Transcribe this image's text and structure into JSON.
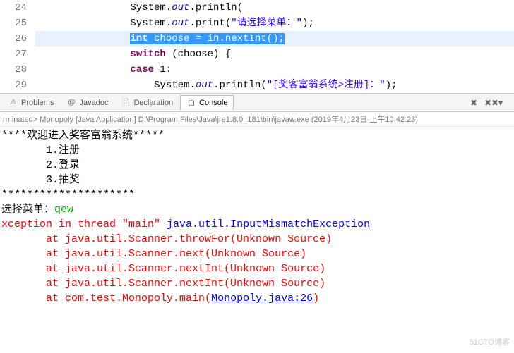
{
  "editor": {
    "lines": [
      {
        "num": "24",
        "indent": "                ",
        "tokens": [
          {
            "t": "System.",
            "c": ""
          },
          {
            "t": "out",
            "c": "field"
          },
          {
            "t": ".println(",
            "c": ""
          }
        ]
      },
      {
        "num": "25",
        "indent": "                ",
        "tokens": [
          {
            "t": "System.",
            "c": ""
          },
          {
            "t": "out",
            "c": "field"
          },
          {
            "t": ".print(",
            "c": ""
          },
          {
            "t": "\"请选择菜单：\"",
            "c": "str"
          },
          {
            "t": ");",
            "c": ""
          }
        ]
      },
      {
        "num": "26",
        "indent": "                ",
        "highlight": true,
        "selected": true,
        "tokens": [
          {
            "t": "int",
            "c": "kw"
          },
          {
            "t": " choose = in.nextInt();",
            "c": ""
          }
        ]
      },
      {
        "num": "27",
        "indent": "                ",
        "tokens": [
          {
            "t": "switch",
            "c": "kw"
          },
          {
            "t": " (choose) {",
            "c": ""
          }
        ]
      },
      {
        "num": "28",
        "indent": "                ",
        "tokens": [
          {
            "t": "case",
            "c": "kw"
          },
          {
            "t": " 1:",
            "c": ""
          }
        ]
      },
      {
        "num": "29",
        "indent": "                    ",
        "tokens": [
          {
            "t": "System.",
            "c": ""
          },
          {
            "t": "out",
            "c": "field"
          },
          {
            "t": ".println(",
            "c": ""
          },
          {
            "t": "\"[奖客富翁系统>注册]：\"",
            "c": "str"
          },
          {
            "t": ");",
            "c": ""
          }
        ]
      }
    ]
  },
  "views": {
    "tabs": [
      {
        "label": "Problems",
        "icon": "⚠",
        "active": false
      },
      {
        "label": "Javadoc",
        "icon": "@",
        "active": false
      },
      {
        "label": "Declaration",
        "icon": "📄",
        "active": false
      },
      {
        "label": "Console",
        "icon": "▢",
        "active": true
      }
    ]
  },
  "console_header": "rminated> Monopoly [Java Application] D:\\Program Files\\Java\\jre1.8.0_181\\bin\\javaw.exe (2019年4月23日 上午10:42:23)",
  "console": {
    "lines": [
      {
        "segs": [
          {
            "t": "****欢迎进入奖客富翁系统*****"
          }
        ]
      },
      {
        "segs": [
          {
            "t": "       1.注册"
          }
        ]
      },
      {
        "segs": [
          {
            "t": "       2.登录"
          }
        ]
      },
      {
        "segs": [
          {
            "t": "       3.抽奖"
          }
        ]
      },
      {
        "segs": [
          {
            "t": "*********************"
          }
        ]
      },
      {
        "segs": [
          {
            "t": "选择菜单："
          },
          {
            "t": "qew",
            "c": "green-in"
          }
        ]
      },
      {
        "segs": [
          {
            "t": "xception in thread \"main\" ",
            "c": "err"
          },
          {
            "t": "java.util.InputMismatchException",
            "c": "err-link"
          }
        ]
      },
      {
        "segs": [
          {
            "t": "       at java.util.Scanner.throwFor(Unknown Source)",
            "c": "err"
          }
        ]
      },
      {
        "segs": [
          {
            "t": "       at java.util.Scanner.next(Unknown Source)",
            "c": "err"
          }
        ]
      },
      {
        "segs": [
          {
            "t": "       at java.util.Scanner.nextInt(Unknown Source)",
            "c": "err"
          }
        ]
      },
      {
        "segs": [
          {
            "t": "       at java.util.Scanner.nextInt(Unknown Source)",
            "c": "err"
          }
        ]
      },
      {
        "segs": [
          {
            "t": "       at com.test.Monopoly.main(",
            "c": "err"
          },
          {
            "t": "Monopoly.java:26",
            "c": "err-link"
          },
          {
            "t": ")",
            "c": "err"
          }
        ]
      }
    ]
  },
  "watermark": "51CTO博客"
}
